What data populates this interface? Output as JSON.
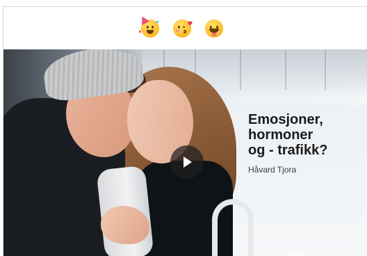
{
  "reactions": [
    {
      "icon": "party-face-icon"
    },
    {
      "icon": "kissing-heart-face-icon"
    },
    {
      "icon": "tongue-out-face-icon"
    }
  ],
  "video": {
    "title": "Emosjoner,\nhormoner\nog - trafikk?",
    "author": "Håvard Tjora",
    "play_icon": "play-icon"
  },
  "colors": {
    "title_text": "#1b1b1b",
    "play_overlay": "#1e1e1e",
    "emoji_yellow": "#fbc02d"
  }
}
